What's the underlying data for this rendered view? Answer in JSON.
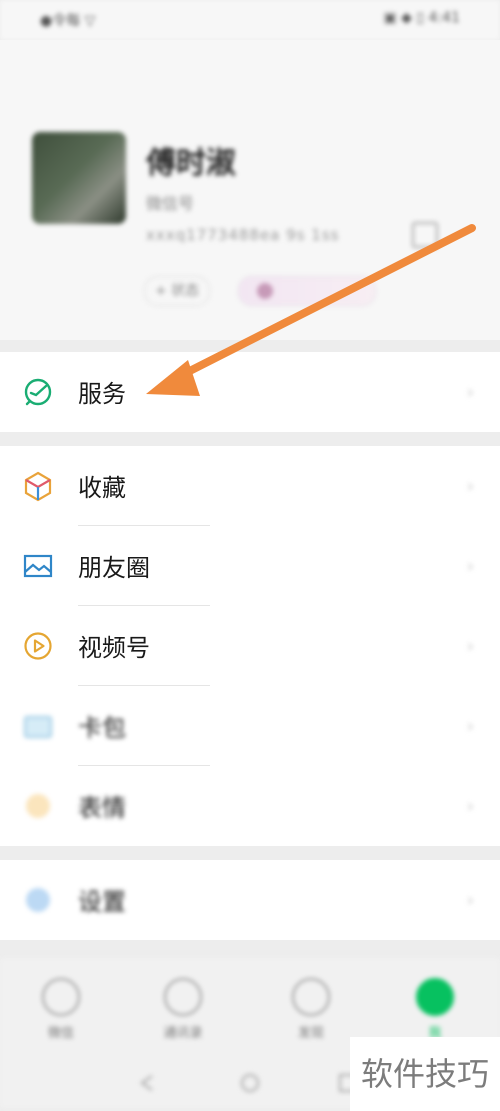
{
  "status_bar": {
    "left": "●令每 ▽",
    "right": "▣ ◆ ▯ 4:41"
  },
  "profile": {
    "nickname": "傅时淑",
    "wechat_id": "微信号",
    "wechat_sub": "xxxq1773488ea 9s 1ss",
    "status_chip": "+ 状态"
  },
  "rows": {
    "services": "服务",
    "favorites": "收藏",
    "moments": "朋友圈",
    "channels": "视频号",
    "cards": "卡包",
    "stickers": "表情",
    "settings": "设置"
  },
  "tabbar": {
    "chats": "微信",
    "contacts": "通讯录",
    "discover": "发现",
    "me": "我"
  },
  "watermark": "软件技巧",
  "colors": {
    "accent_arrow": "#f08a3c",
    "green": "#07c160"
  }
}
